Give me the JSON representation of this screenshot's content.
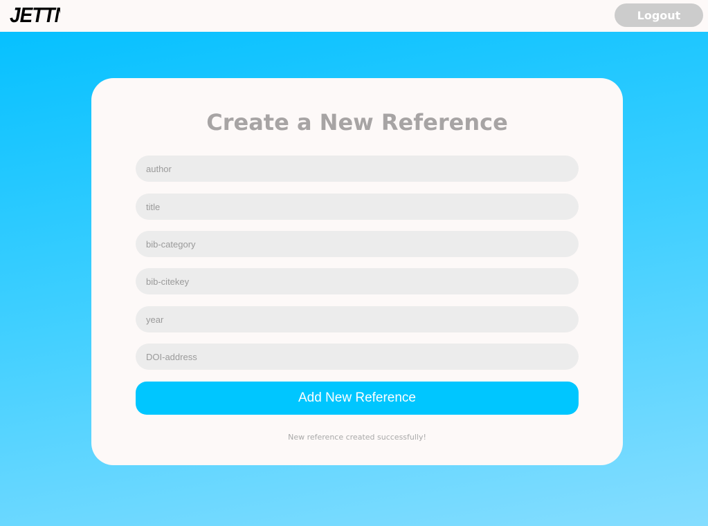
{
  "header": {
    "logo": "JETTN",
    "logout_label": "Logout"
  },
  "form": {
    "title": "Create a New Reference",
    "fields": [
      {
        "placeholder": "author",
        "value": ""
      },
      {
        "placeholder": "title",
        "value": ""
      },
      {
        "placeholder": "bib-category",
        "value": ""
      },
      {
        "placeholder": "bib-citekey",
        "value": ""
      },
      {
        "placeholder": "year",
        "value": ""
      },
      {
        "placeholder": "DOI-address",
        "value": ""
      }
    ],
    "submit_label": "Add New Reference",
    "status_message": "New reference created successfully!"
  },
  "colors": {
    "accent": "#00c6ff",
    "background_top": "#00bfff",
    "card": "#fdf9f8"
  }
}
